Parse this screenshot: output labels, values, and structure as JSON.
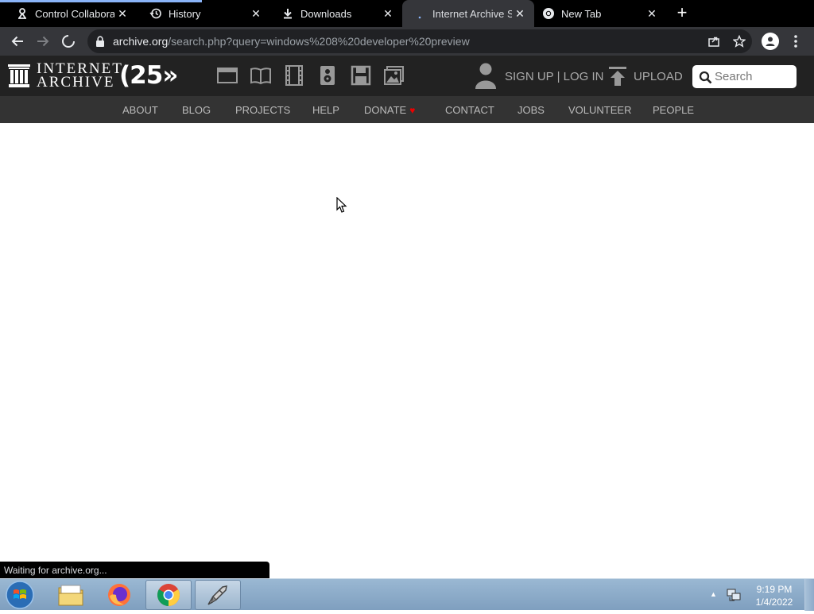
{
  "browser": {
    "tabs": [
      {
        "title": "Control Collaborati",
        "icon": "webhook-icon",
        "active": false
      },
      {
        "title": "History",
        "icon": "history-icon",
        "active": false
      },
      {
        "title": "Downloads",
        "icon": "download-icon",
        "active": false
      },
      {
        "title": "Internet Archive Se",
        "icon": "loading-icon",
        "active": true
      },
      {
        "title": "New Tab",
        "icon": "chrome-icon",
        "active": false
      }
    ],
    "url_host": "archive.org",
    "url_path": "/search.php?query=windows%208%20developer%20preview",
    "status_text": "Waiting for archive.org..."
  },
  "ia": {
    "logo_line1": "INTERNET",
    "logo_line2": "ARCHIVE",
    "anniversary": "25",
    "media_icons": [
      "web-icon",
      "texts-icon",
      "video-icon",
      "audio-icon",
      "software-icon",
      "images-icon"
    ],
    "signup_label": "SIGN UP | LOG IN",
    "upload_label": "UPLOAD",
    "search_placeholder": "Search",
    "nav": [
      "ABOUT",
      "BLOG",
      "PROJECTS",
      "HELP",
      "DONATE",
      "CONTACT",
      "JOBS",
      "VOLUNTEER",
      "PEOPLE"
    ],
    "donate_heart": "♥"
  },
  "taskbar": {
    "apps": [
      "file-explorer-icon",
      "firefox-icon",
      "chrome-icon",
      "remote-app-icon"
    ],
    "time": "9:19 PM",
    "date": "1/4/2022"
  },
  "colors": {
    "tabstrip": "#000000",
    "toolbar": "#35363a",
    "ia_header": "#222222",
    "ia_nav": "#333333",
    "donate_heart": "#ee0000"
  }
}
